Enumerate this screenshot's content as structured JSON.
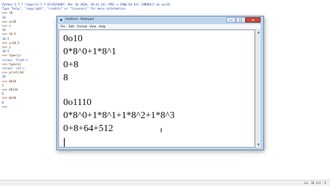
{
  "shell": {
    "lines": [
      {
        "text": "Python 3.7.7 (tags/v3.7.7:d7c567b08f, Mar 10 2020, 10:41:24) [MSC v.1900 64 bit (AMD64)] on win32",
        "kind": "out"
      },
      {
        "text": "Type \"help\", \"copyright\", \"credits\" or \"license()\" for more information.",
        "kind": "out"
      },
      {
        "text": ">>> 10",
        "kind": "prompt"
      },
      {
        "text": "10",
        "kind": "out"
      },
      {
        "text": ">>> a=10",
        "kind": "prompt"
      },
      {
        "text": ">>> a",
        "kind": "prompt"
      },
      {
        "text": "10",
        "kind": "out"
      },
      {
        "text": ">>> 10.5",
        "kind": "prompt"
      },
      {
        "text": "10.5",
        "kind": "out"
      },
      {
        "text": ">>> y=10.5",
        "kind": "prompt"
      },
      {
        "text": ">>> y",
        "kind": "prompt"
      },
      {
        "text": "10.5",
        "kind": "out"
      },
      {
        "text": ">>> type(y)",
        "kind": "prompt"
      },
      {
        "text": "<class 'float'>",
        "kind": "out"
      },
      {
        "text": ">>> type(a)",
        "kind": "prompt"
      },
      {
        "text": "<class 'int'>",
        "kind": "out"
      },
      {
        "text": ">>> print(10)",
        "kind": "prompt"
      },
      {
        "text": "10",
        "kind": "out"
      },
      {
        "text": ">>> 0b10",
        "kind": "prompt"
      },
      {
        "text": "2",
        "kind": "out"
      },
      {
        "text": ">>> 0b110",
        "kind": "prompt"
      },
      {
        "text": "6",
        "kind": "out"
      },
      {
        "text": ">>> 0o10",
        "kind": "prompt"
      },
      {
        "text": "8",
        "kind": "out"
      },
      {
        "text": ">>>",
        "kind": "prompt"
      }
    ],
    "status": "Ln: 26   Col: 4"
  },
  "notepad": {
    "title": "Untitled - Notepad",
    "buttons": {
      "minimize": "—",
      "maximize": "☐",
      "close": "✕"
    },
    "menu": [
      "File",
      "Edit",
      "Format",
      "View",
      "Help"
    ],
    "lines": [
      "0o10",
      "0*8^0+1*8^1",
      "0+8",
      "8",
      "",
      "0o1110",
      "0*8^0+1*8^1+1*8^2+1*8^3",
      "0+8+64+512"
    ],
    "scroll_up": "▲",
    "scroll_down": "▼",
    "grip": "⋰",
    "ibeam": "I"
  }
}
